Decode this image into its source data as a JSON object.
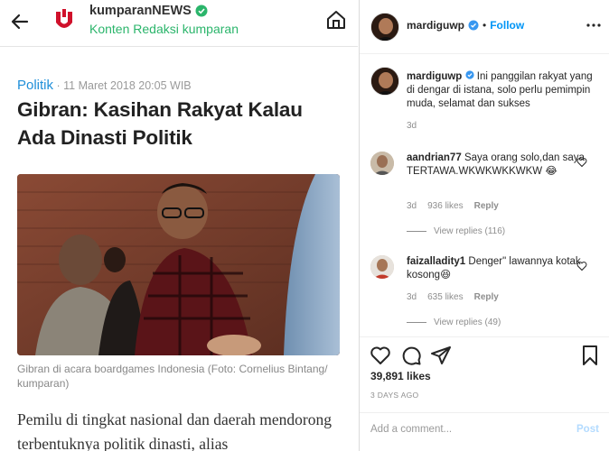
{
  "article": {
    "source_name": "kumparanNEWS",
    "source_subtitle": "Konten Redaksi kumparan",
    "category": "Politik",
    "date": " · 11 Maret 2018 20:05 WIB",
    "headline": "Gibran: Kasihan Rakyat Kalau Ada Dinasti Politik",
    "photo_caption": "Gibran di acara boardgames Indonesia (Foto: Cornelius Bintang/ kumparan)",
    "body": "Pemilu di tingkat nasional dan daerah mendorong terbentuknya politik dinasti, alias",
    "colors": {
      "accent_green": "#2bb56b",
      "category_blue": "#1f8fd9",
      "brand_red": "#d0112b"
    }
  },
  "instagram": {
    "username": "mardiguwp",
    "follow_label": "Follow",
    "caption": {
      "username": "mardiguwp",
      "text": "Ini panggilan rakyat yang di dengar di istana, solo perlu pemimpin muda, selamat dan sukses",
      "time": "3d"
    },
    "comments": [
      {
        "username": "aandrian77",
        "text": "Saya orang solo,dan saya TERTAWA.WKWKWKKWKW 😂",
        "time": "3d",
        "likes": "936 likes",
        "reply": "Reply",
        "view_replies": "View replies (116)"
      },
      {
        "username": "faizalladity1",
        "text": "Denger\" lawannya kotak kosong😆",
        "time": "3d",
        "likes": "635 likes",
        "reply": "Reply",
        "view_replies": "View replies (49)"
      }
    ],
    "likes_count": "39,891 likes",
    "posted_ago": "3 DAYS AGO",
    "add_comment_placeholder": "Add a comment...",
    "post_label": "Post",
    "colors": {
      "link_blue": "#0095f6",
      "muted": "#8e8e8e"
    },
    "icons": [
      "heart-icon",
      "comment-icon",
      "share-icon",
      "bookmark-icon",
      "more-options-icon",
      "verified-badge-icon"
    ]
  }
}
